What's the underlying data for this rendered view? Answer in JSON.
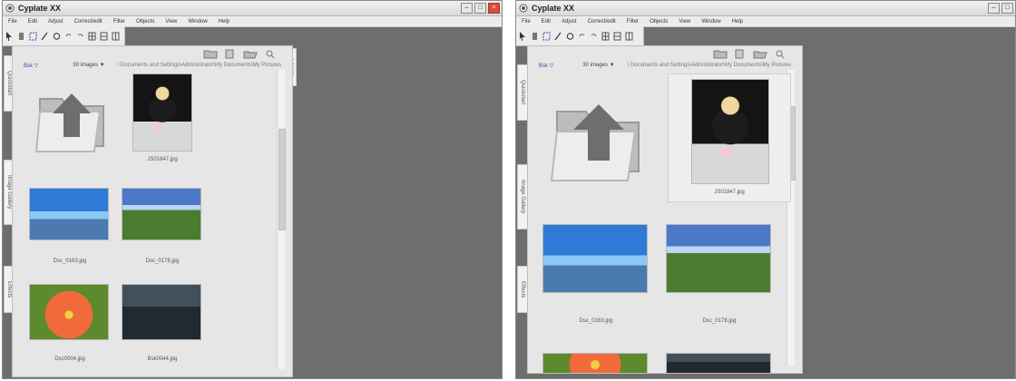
{
  "app": {
    "title": "Cyplate XX",
    "menu": [
      "File",
      "Edit",
      "Adjust",
      "Correct/edit",
      "Filter",
      "Objects",
      "View",
      "Window",
      "Help"
    ]
  },
  "toolbar_icons": [
    "arrow-icon",
    "hand-icon",
    "select-icon",
    "wand-icon",
    "rotate-icon",
    "undo-icon",
    "redo-icon",
    "grid-icon",
    "grid-icon",
    "grid-icon"
  ],
  "action_icons": [
    "add-folder-icon",
    "add-file-icon",
    "folder-open-icon",
    "find-icon"
  ],
  "breadcrumb": {
    "up": "Bsk ▽",
    "count": "30 images ▼",
    "path": "\\ Documents and Settings\\Administrator\\My Documents\\My Pictures"
  },
  "side_tabs": {
    "left_top": "Quickstart",
    "left_middle": "Image Gallery",
    "left_bottom": "Effects",
    "right_top": "Layers"
  },
  "left_window": {
    "items": [
      {
        "type": "folder",
        "label": ""
      },
      {
        "type": "image",
        "label": "JS01847.jpg",
        "variant": "portrait"
      },
      {
        "type": "image",
        "label": "Dsc_0163.jpg",
        "variant": "bridge"
      },
      {
        "type": "image",
        "label": "Dsc_0178.jpg",
        "variant": "field"
      },
      {
        "type": "image",
        "label": "Dsc0004.jpg",
        "variant": "flower"
      },
      {
        "type": "image",
        "label": "Bsk0044.jpg",
        "variant": "city"
      }
    ]
  },
  "right_window": {
    "items": [
      {
        "type": "folder",
        "label": ""
      },
      {
        "type": "image",
        "label": "JS01847.jpg",
        "variant": "portrait"
      },
      {
        "type": "image",
        "label": "Dsc_0163.jpg",
        "variant": "bridge"
      },
      {
        "type": "image",
        "label": "Dsc_0178.jpg",
        "variant": "field"
      }
    ]
  },
  "colors": {
    "workspace": "#6e6e6e",
    "panel": "#e6e6e6",
    "accent": "#2a4f9e"
  }
}
